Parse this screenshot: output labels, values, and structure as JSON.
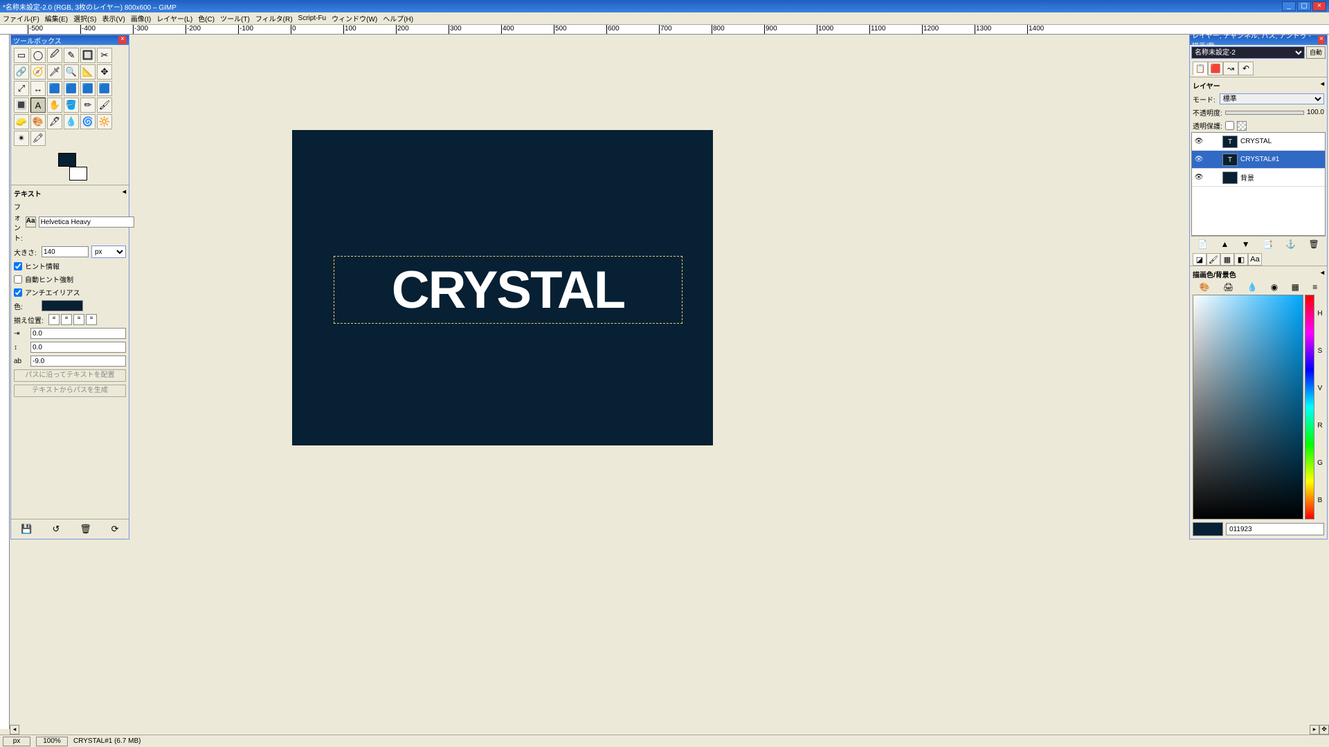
{
  "titlebar": {
    "text": "*名称未設定-2.0 (RGB, 3枚のレイヤー) 800x600 – GIMP"
  },
  "menu": [
    "ファイル(F)",
    "編集(E)",
    "選択(S)",
    "表示(V)",
    "画像(I)",
    "レイヤー(L)",
    "色(C)",
    "ツール(T)",
    "フィルタ(R)",
    "Script-Fu",
    "ウィンドウ(W)",
    "ヘルプ(H)"
  ],
  "ruler_ticks": [
    "-500",
    "-400",
    "-300",
    "-200",
    "-100",
    "0",
    "100",
    "200",
    "300",
    "400",
    "500",
    "600",
    "700",
    "800",
    "900",
    "1000",
    "1100",
    "1200",
    "1300",
    "1400"
  ],
  "toolbox": {
    "title": "ツールボックス",
    "tools": [
      "▭",
      "◯",
      "🖉",
      "✎",
      "🔲",
      "✂",
      "🔗",
      "🧭",
      "🗡",
      "🔍",
      "📐",
      "✥",
      "⤢",
      "↔",
      "🟦",
      "🟦",
      "🟦",
      "🟦",
      "🔳",
      "A",
      "✋",
      "🪣",
      "✏",
      "🖌",
      "🧽",
      "🎨",
      "🖋",
      "💧",
      "🌀",
      "🔆",
      "✴",
      "🖍"
    ],
    "active_tool_index": 19,
    "options": {
      "header": "テキスト",
      "font_label": "フォント:",
      "font_badge": "Aa",
      "font_value": "Helvetica Heavy",
      "size_label": "大きさ:",
      "size_value": "140",
      "size_unit": "px",
      "chk_hint": "ヒント情報",
      "chk_auto": "自動ヒント強制",
      "chk_aa": "アンチエイリアス",
      "color_label": "色:",
      "justify_label": "揃え位置:",
      "indent_a": "0.0",
      "indent_b": "0.0",
      "indent_c": "-9.0",
      "btn_path1": "パスに沿ってテキストを配置",
      "btn_path2": "テキストからパスを生成"
    }
  },
  "canvas": {
    "text": "CRYSTAL"
  },
  "rightdock": {
    "title": "レイヤー, チャンネル, パス, アンドゥ - 描画/背...",
    "image_select": "名称未設定-2",
    "auto_btn": "自動",
    "layer": {
      "header": "レイヤー",
      "mode_label": "モード:",
      "mode_value": "標準",
      "opacity_label": "不透明度:",
      "opacity_value": "100.0",
      "lock_label": "透明保護:",
      "rows": [
        {
          "name": "CRYSTAL"
        },
        {
          "name": "CRYSTAL#1"
        },
        {
          "name": "背景"
        }
      ],
      "selected": 1
    },
    "color": {
      "header": "描画色/背景色",
      "hex": "011923",
      "letters": [
        "H",
        "S",
        "V",
        "R",
        "G",
        "B"
      ]
    }
  },
  "statusbar": {
    "unit": "px",
    "zoom": "100%",
    "info": "CRYSTAL#1 (6.7 MB)"
  }
}
